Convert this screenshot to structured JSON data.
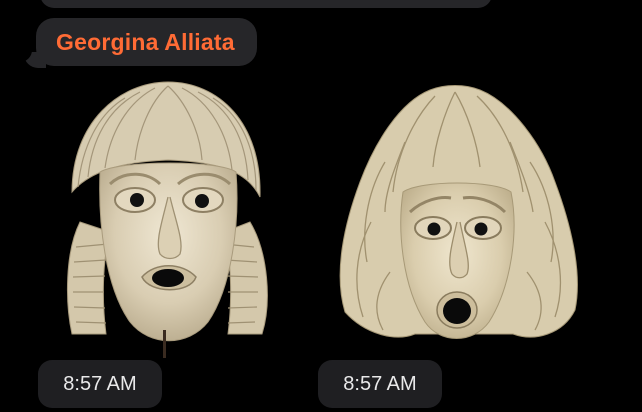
{
  "chat": {
    "sender_name": "Georgina Alliata",
    "colors": {
      "background": "#000000",
      "bubble": "#262629",
      "sender_name": "#FF6B35",
      "time_pill": "#1F1F22",
      "time_text": "#E9E9EA"
    },
    "messages": [
      {
        "image": "comedy-mask-photo",
        "time": "8:57 AM"
      },
      {
        "image": "tragedy-mask-photo",
        "time": "8:57 AM"
      }
    ]
  }
}
